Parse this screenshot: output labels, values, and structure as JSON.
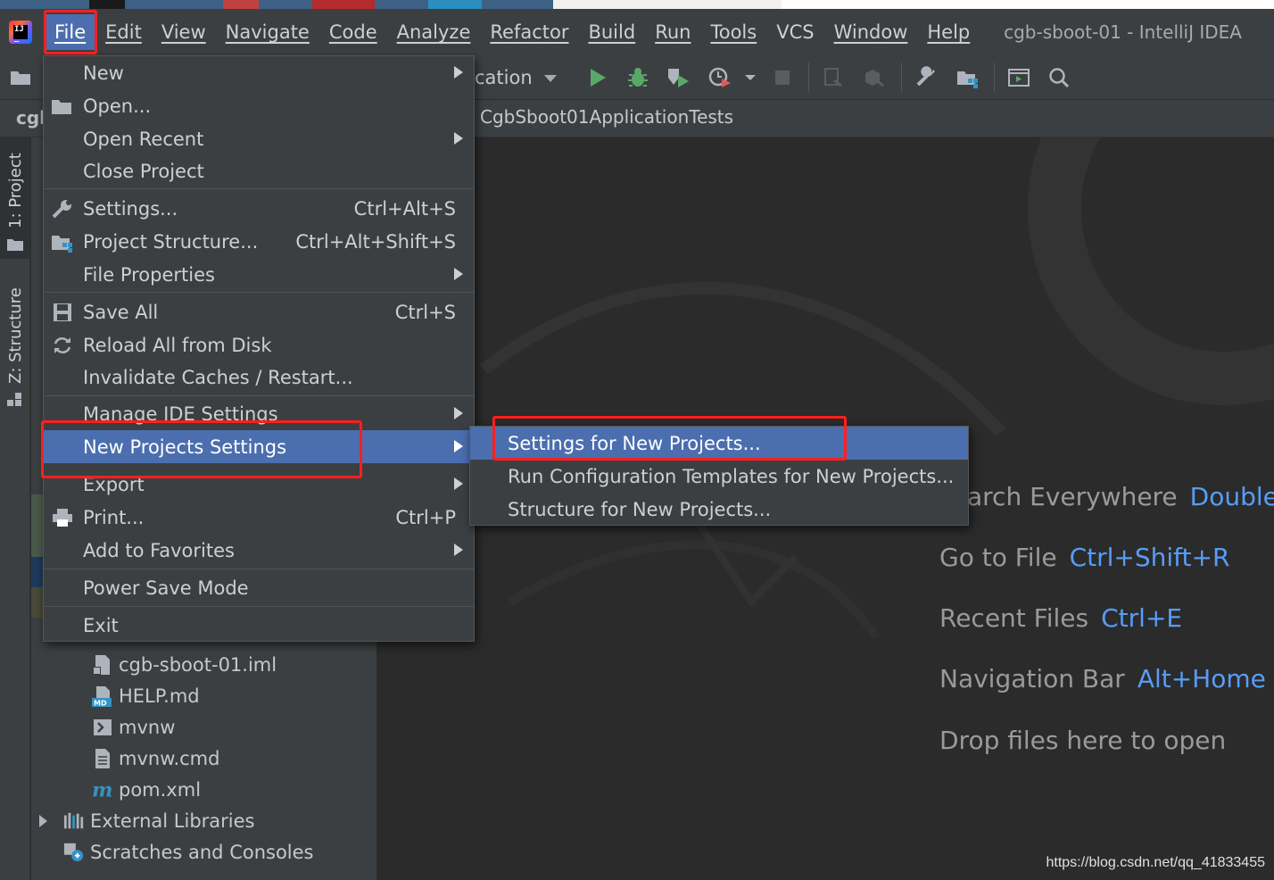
{
  "menubar": {
    "items": [
      "File",
      "Edit",
      "View",
      "Navigate",
      "Code",
      "Analyze",
      "Refactor",
      "Build",
      "Run",
      "Tools",
      "VCS",
      "Window",
      "Help"
    ],
    "active": "File",
    "window_title": "cgb-sboot-01 - IntelliJ IDEA"
  },
  "toolbar": {
    "run_config": "cation",
    "project_abbrev": "cgl",
    "breadcrumb": "CgbSboot01ApplicationTests"
  },
  "side_strip": {
    "project_tab": "1: Project",
    "structure_tab": "Z: Structure"
  },
  "file_menu": {
    "items": [
      {
        "label": "New",
        "shortcut": "",
        "submenu": true
      },
      {
        "label": "Open...",
        "shortcut": "",
        "submenu": false
      },
      {
        "label": "Open Recent",
        "shortcut": "",
        "submenu": true
      },
      {
        "label": "Close Project",
        "shortcut": "",
        "submenu": false
      },
      {
        "label": "Settings...",
        "shortcut": "Ctrl+Alt+S",
        "submenu": false
      },
      {
        "label": "Project Structure...",
        "shortcut": "Ctrl+Alt+Shift+S",
        "submenu": false
      },
      {
        "label": "File Properties",
        "shortcut": "",
        "submenu": true
      },
      {
        "label": "Save All",
        "shortcut": "Ctrl+S",
        "submenu": false
      },
      {
        "label": "Reload All from Disk",
        "shortcut": "",
        "submenu": false
      },
      {
        "label": "Invalidate Caches / Restart...",
        "shortcut": "",
        "submenu": false
      },
      {
        "label": "Manage IDE Settings",
        "shortcut": "",
        "submenu": true
      },
      {
        "label": "New Projects Settings",
        "shortcut": "",
        "submenu": true
      },
      {
        "label": "Export",
        "shortcut": "",
        "submenu": true
      },
      {
        "label": "Print...",
        "shortcut": "Ctrl+P",
        "submenu": false
      },
      {
        "label": "Add to Favorites",
        "shortcut": "",
        "submenu": true
      },
      {
        "label": "Power Save Mode",
        "shortcut": "",
        "submenu": false
      },
      {
        "label": "Exit",
        "shortcut": "",
        "submenu": false
      }
    ],
    "selected": "New Projects Settings"
  },
  "submenu": {
    "items": [
      "Settings for New Projects...",
      "Run Configuration Templates for New Projects...",
      "Structure for New Projects..."
    ],
    "selected": "Settings for New Projects..."
  },
  "project_tree": {
    "items": [
      {
        "label": "cgb-sboot-01.iml",
        "icon": "module-file-icon"
      },
      {
        "label": "HELP.md",
        "icon": "markdown-file-icon"
      },
      {
        "label": "mvnw",
        "icon": "shell-script-icon"
      },
      {
        "label": "mvnw.cmd",
        "icon": "text-file-icon"
      },
      {
        "label": "pom.xml",
        "icon": "maven-icon"
      },
      {
        "label": "External Libraries",
        "icon": "libraries-icon"
      },
      {
        "label": "Scratches and Consoles",
        "icon": "scratches-icon"
      }
    ]
  },
  "editor_hints": [
    {
      "label": "arch Everywhere",
      "key": "Double S"
    },
    {
      "label": "Go to File",
      "key": "Ctrl+Shift+R"
    },
    {
      "label": "Recent Files",
      "key": "Ctrl+E"
    },
    {
      "label": "Navigation Bar",
      "key": "Alt+Home"
    },
    {
      "label": "Drop files here to open",
      "key": ""
    }
  ],
  "watermark": "https://blog.csdn.net/qq_41833455",
  "colors": {
    "selection": "#4b6eaf",
    "annotation": "#ff1f1f",
    "key_hint": "#589df6"
  }
}
